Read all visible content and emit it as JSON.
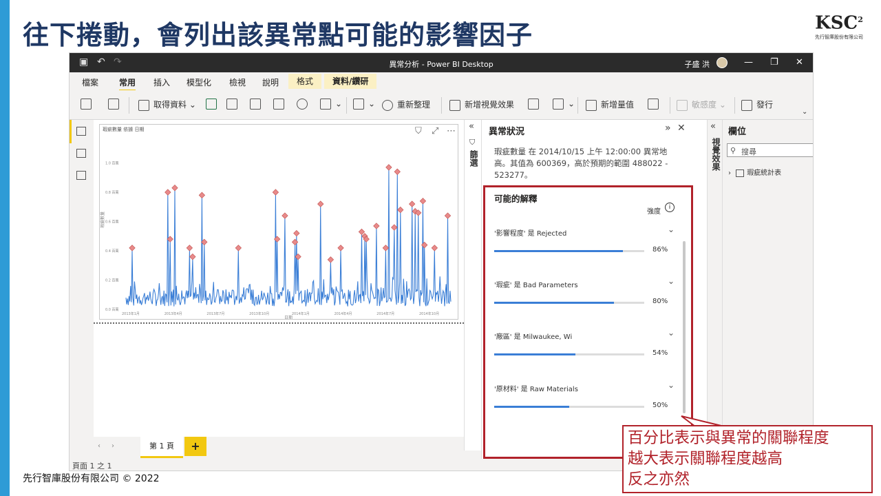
{
  "slide": {
    "title": "往下捲動，會列出該異常點可能的影響因子",
    "logo_text": "KSC",
    "logo_sup": "2",
    "logo_sub": "先行智庫股份有限公司",
    "footer": "先行智庫股份有限公司 © 2022",
    "accent_color": "#2e9bd6",
    "highlight_color": "#b1222a"
  },
  "window": {
    "title": "異常分析 - Power BI Desktop",
    "user": "子盛 洪",
    "minimize": "—",
    "restore": "❐",
    "close": "✕"
  },
  "menu": {
    "file": "檔案",
    "home": "常用",
    "insert": "插入",
    "modeling": "模型化",
    "view": "檢視",
    "help": "說明",
    "format": "格式",
    "data_drill": "資料/鑽研"
  },
  "ribbon": {
    "get_data": "取得資料",
    "refresh": "重新整理",
    "new_visual": "新增視覺效果",
    "new_measure": "新增量值",
    "sensitivity": "敏感度",
    "publish": "發行"
  },
  "visual": {
    "title": "瑕疵數量 依據 日期",
    "x_axis_title": "日期"
  },
  "chart_data": {
    "type": "line",
    "title": "瑕疵數量 依據 日期",
    "xlabel": "日期",
    "ylabel": "瑕疵數量",
    "y_ticks": [
      "0.0 百萬",
      "0.2 百萬",
      "0.4 百萬",
      "0.6 百萬",
      "0.8 百萬",
      "1.0 百萬"
    ],
    "x_ticks": [
      "2013年1月",
      "2013年4月",
      "2013年7月",
      "2013年10月",
      "2014年1月",
      "2014年4月",
      "2014年7月",
      "2014年10月"
    ],
    "ylim": [
      0,
      1.1
    ],
    "anomaly_marker": "diamond",
    "line_color": "#3a7ed6",
    "marker_color": "#e88a8a"
  },
  "filters": {
    "label": "篩選"
  },
  "anomaly": {
    "header": "異常狀況",
    "description": "瑕疵數量 在 2014/10/15 上午 12:00:00 異常地高。其值為 600369，高於預期的範圍 488022 - 523277。",
    "explanations_title": "可能的解釋",
    "strength_label": "強度",
    "factors": [
      {
        "label": "'影響程度' 是 Rejected",
        "value": 0.86,
        "pct": "86%"
      },
      {
        "label": "'瑕疵' 是 Bad Parameters",
        "value": 0.8,
        "pct": "80%"
      },
      {
        "label": "'廠區' 是 Milwaukee, Wi",
        "value": 0.54,
        "pct": "54%"
      },
      {
        "label": "'原材料' 是 Raw Materials",
        "value": 0.5,
        "pct": "50%"
      }
    ]
  },
  "viseffects": {
    "label": "視覺效果"
  },
  "fields": {
    "header": "欄位",
    "search_placeholder": "搜尋",
    "table_name": "瑕疵統計表"
  },
  "pages": {
    "page1": "第 1 頁",
    "add": "+",
    "status": "頁面 1 之 1"
  },
  "callout": {
    "line1": "百分比表示與異常的關聯程度",
    "line2": "越大表示關聯程度越高",
    "line3": "反之亦然"
  }
}
